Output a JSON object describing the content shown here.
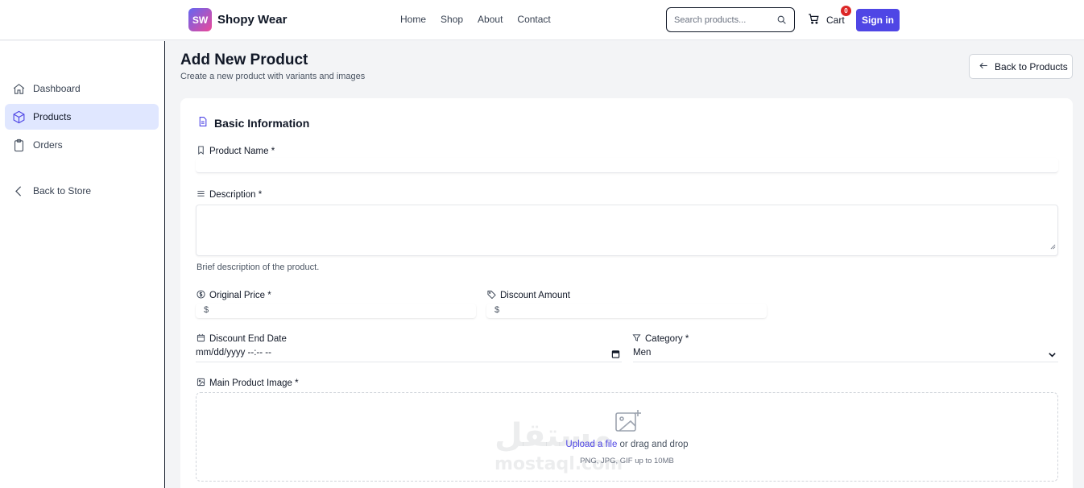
{
  "brand": {
    "badge": "SW",
    "name": "Shopy Wear"
  },
  "nav": {
    "links": [
      "Home",
      "Shop",
      "About",
      "Contact"
    ]
  },
  "search": {
    "placeholder": "Search products..."
  },
  "cart": {
    "label": "Cart",
    "count": "0"
  },
  "auth": {
    "signin_label": "Sign in"
  },
  "sidebar": {
    "items": [
      {
        "label": "Dashboard",
        "icon": "home-icon",
        "active": false
      },
      {
        "label": "Products",
        "icon": "box-icon",
        "active": true
      },
      {
        "label": "Orders",
        "icon": "clipboard-icon",
        "active": false
      },
      {
        "label": "Back to Store",
        "icon": "chevron-left-icon",
        "active": false
      }
    ]
  },
  "page": {
    "title": "Add New Product",
    "subtitle": "Create a new product with variants and images",
    "back_label": "Back to Products"
  },
  "form": {
    "section_title": "Basic Information",
    "product_name_label": "Product Name *",
    "product_name_value": "",
    "description_label": "Description *",
    "description_value": "",
    "description_helper": "Brief description of the product.",
    "original_price_label": "Original Price *",
    "original_price_currency": "$",
    "discount_amount_label": "Discount Amount",
    "discount_amount_currency": "$",
    "discount_end_date_label": "Discount End Date",
    "discount_end_date_value": "mm/dd/yyyy --:-- --",
    "category_label": "Category *",
    "category_value": "Men",
    "main_image_label": "Main Product Image *",
    "upload_link": "Upload a file",
    "upload_text": " or drag and drop",
    "upload_hint": "PNG, JPG, GIF up to 10MB"
  },
  "watermark": {
    "arabic": "مستقل",
    "latin": "mostaql.com"
  },
  "colors": {
    "accent": "#4f46e5",
    "badge": "#dc2626",
    "active_bg": "#e0e7ff"
  }
}
